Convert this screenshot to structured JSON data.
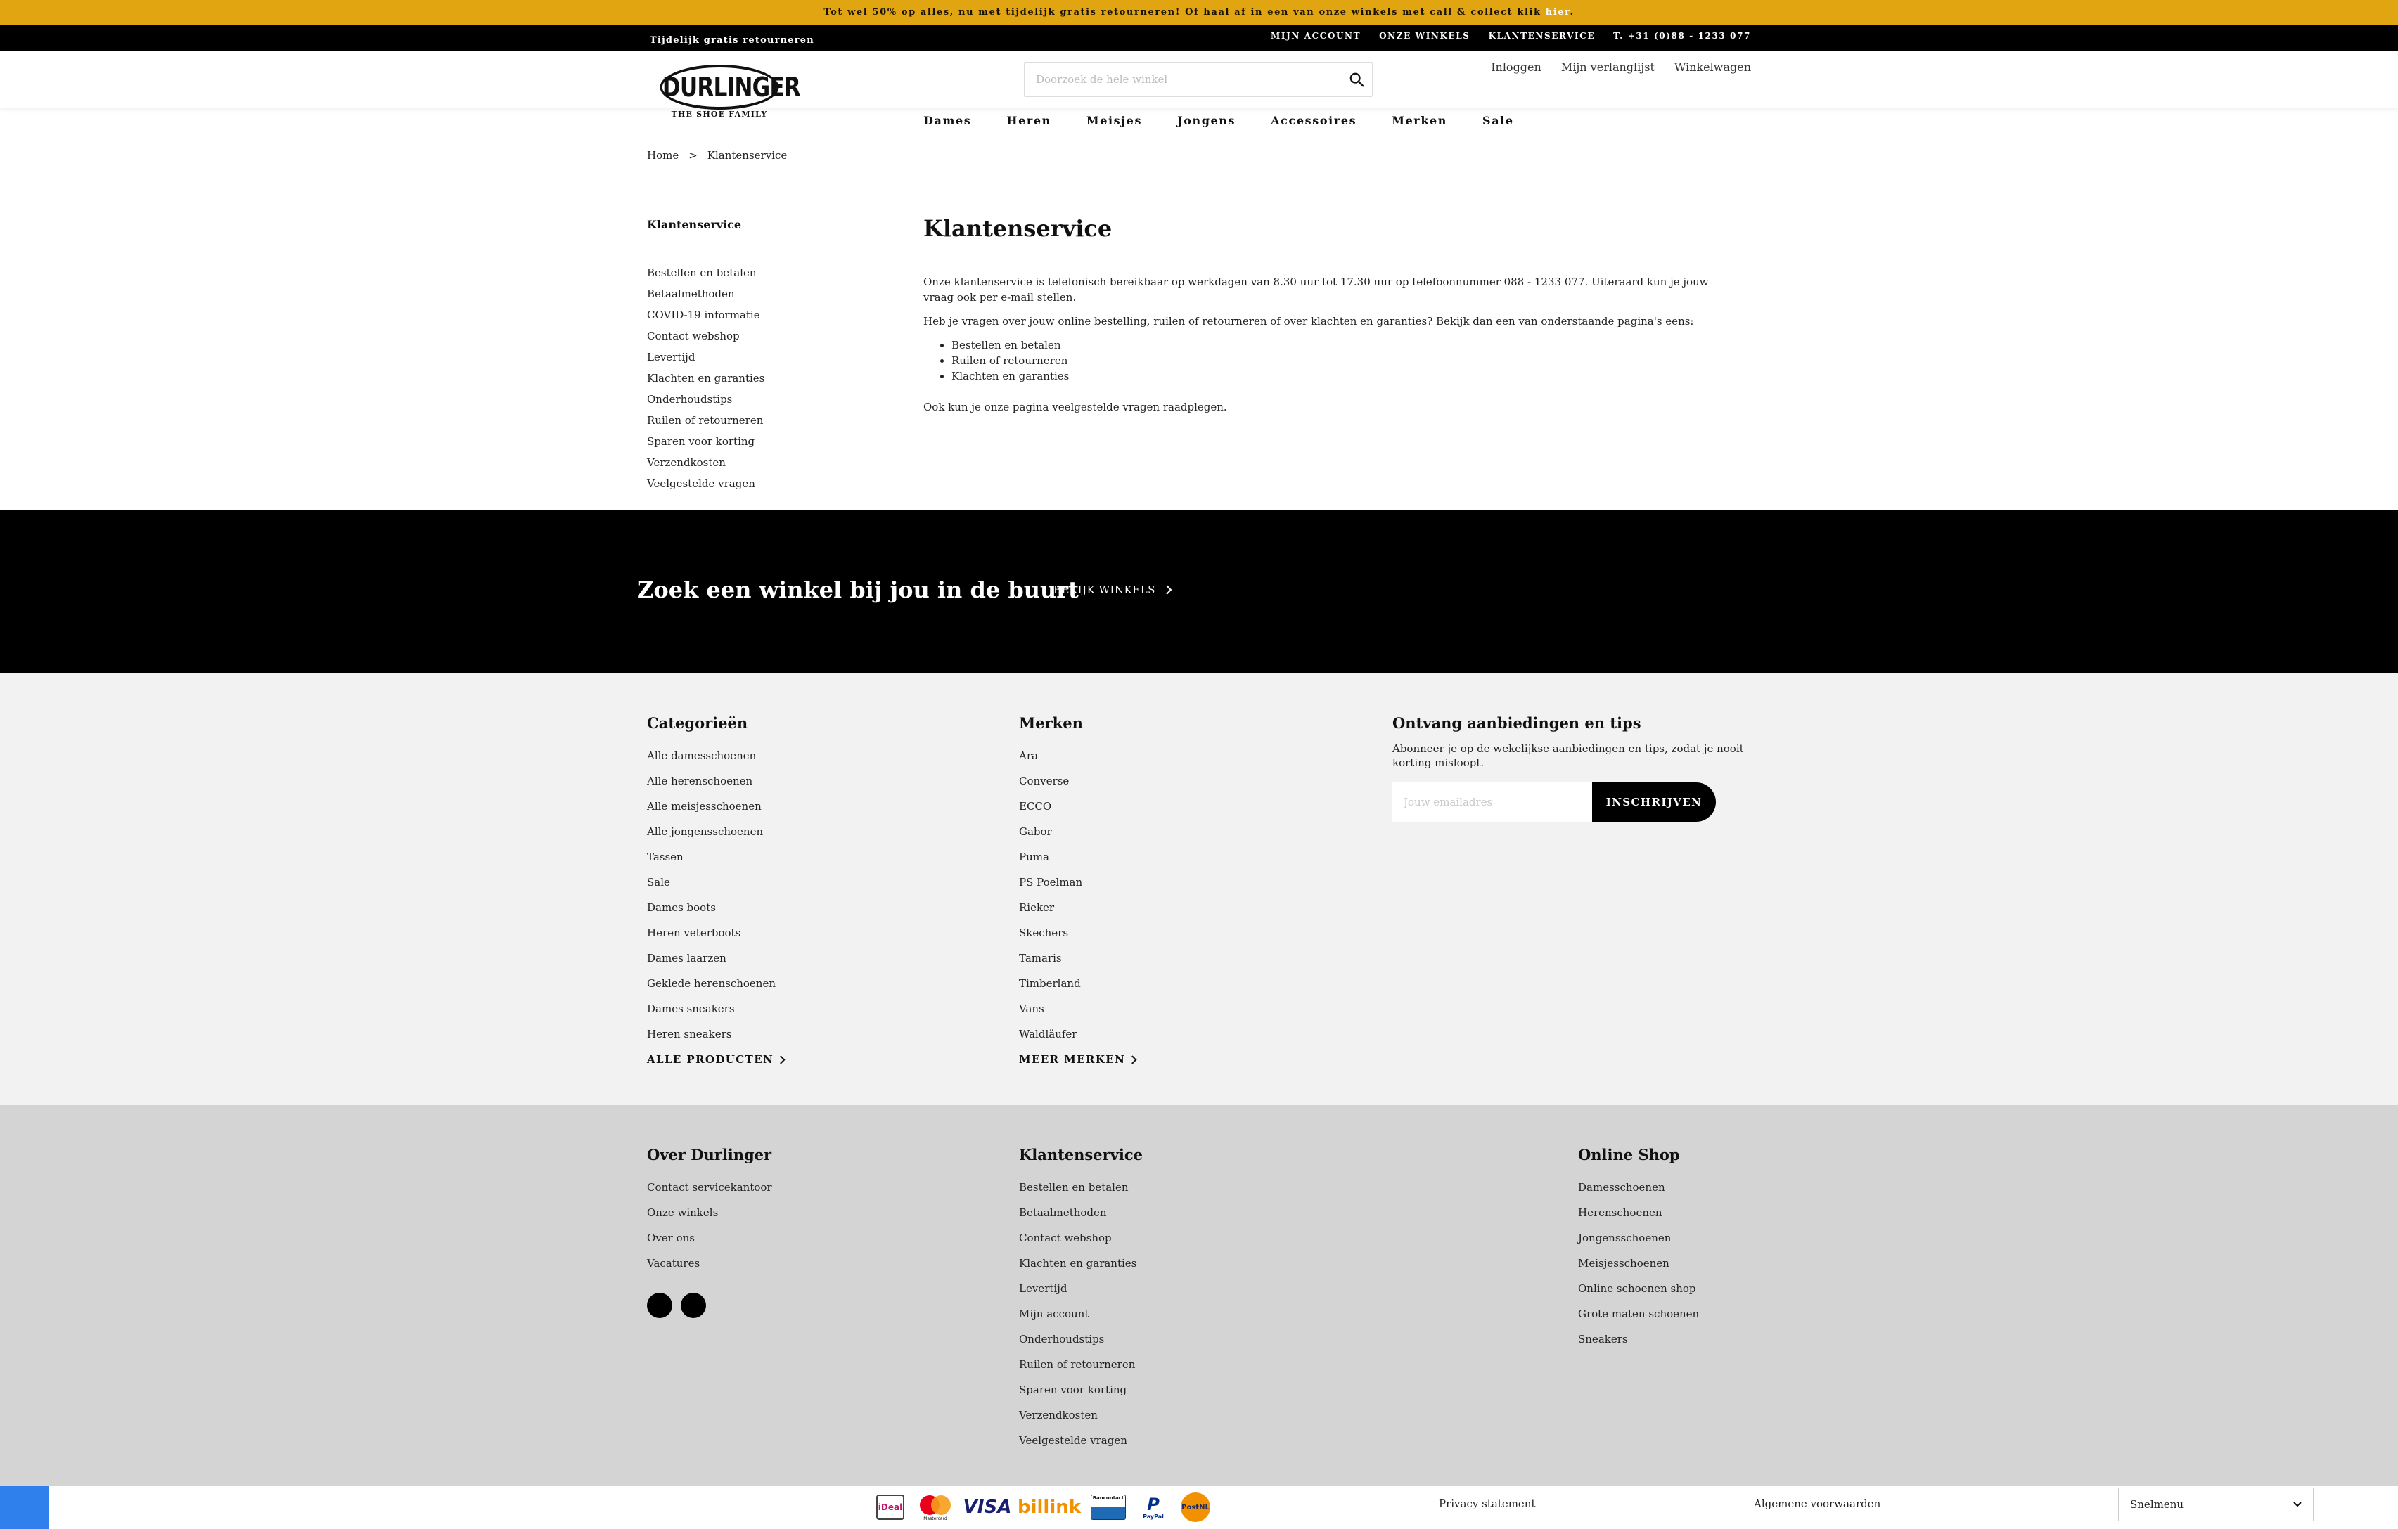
{
  "promo": {
    "text": "Tot wel 50% op alles, nu met tijdelijk gratis retourneren! Of haal af in een van onze winkels met call & collect klik",
    "link": "hier",
    "suffix": "."
  },
  "topbar": {
    "left": "Tijdelijk gratis retourneren",
    "links": [
      "MIJN ACCOUNT",
      "ONZE WINKELS",
      "KLANTENSERVICE",
      "T. +31 (0)88 - 1233 077"
    ]
  },
  "header": {
    "logo_text": "DURLINGER",
    "logo_sub": "THE SHOE FAMILY",
    "search_placeholder": "Doorzoek de hele winkel",
    "user_links": [
      "Inloggen",
      "Mijn verlanglijst",
      "Winkelwagen"
    ]
  },
  "nav": [
    "Dames",
    "Heren",
    "Meisjes",
    "Jongens",
    "Accessoires",
    "Merken",
    "Sale"
  ],
  "breadcrumb": {
    "home": "Home",
    "separator": ">",
    "current": "Klantenservice"
  },
  "sidebar": {
    "title": "Klantenservice",
    "items": [
      "Bestellen en betalen",
      "Betaalmethoden",
      "COVID-19 informatie",
      "Contact webshop",
      "Levertijd",
      "Klachten en garanties",
      "Onderhoudstips",
      "Ruilen of retourneren",
      "Sparen voor korting",
      "Verzendkosten",
      "Veelgestelde vragen"
    ]
  },
  "content": {
    "title": "Klantenservice",
    "p1": "Onze klantenservice is telefonisch bereikbaar op werkdagen van 8.30 uur tot 17.30 uur op telefoonnummer 088 - 1233 077. Uiteraard kun je jouw vraag ook per e-mail stellen.",
    "p2": "Heb je vragen over jouw online bestelling, ruilen of retourneren of over klachten en garanties? Bekijk dan een van onderstaande pagina's eens:",
    "list": [
      "Bestellen en betalen",
      "Ruilen of retourneren",
      "Klachten en garanties"
    ],
    "p3": "Ook kun je onze pagina veelgestelde vragen raadplegen."
  },
  "storeband": {
    "title": "Zoek een winkel bij jou in de buurt",
    "link": "BEKIJK WINKELS"
  },
  "footer_top": {
    "categories": {
      "title": "Categorieën",
      "items": [
        "Alle damesschoenen",
        "Alle herenschoenen",
        "Alle meisjesschoenen",
        "Alle jongensschoenen",
        "Tassen",
        "Sale",
        "Dames boots",
        "Heren veterboots",
        "Dames laarzen",
        "Geklede herenschoenen",
        "Dames sneakers",
        "Heren sneakers"
      ],
      "more": "ALLE PRODUCTEN"
    },
    "brands": {
      "title": "Merken",
      "items": [
        "Ara",
        "Converse",
        "ECCO",
        "Gabor",
        "Puma",
        "PS Poelman",
        "Rieker",
        "Skechers",
        "Tamaris",
        "Timberland",
        "Vans",
        "Waldläufer"
      ],
      "more": "MEER MERKEN"
    },
    "newsletter": {
      "title": "Ontvang aanbiedingen en tips",
      "text": "Abonneer je op de wekelijkse aanbiedingen en tips, zodat je nooit korting misloopt.",
      "placeholder": "Jouw emailadres",
      "button": "INSCHRIJVEN"
    }
  },
  "footer_bottom": {
    "about": {
      "title": "Over Durlinger",
      "items": [
        "Contact servicekantoor",
        "Onze winkels",
        "Over ons",
        "Vacatures"
      ]
    },
    "service": {
      "title": "Klantenservice",
      "items": [
        "Bestellen en betalen",
        "Betaalmethoden",
        "Contact webshop",
        "Klachten en garanties",
        "Levertijd",
        "Mijn account",
        "Onderhoudstips",
        "Ruilen of retourneren",
        "Sparen voor korting",
        "Verzendkosten",
        "Veelgestelde vragen"
      ]
    },
    "shop": {
      "title": "Online Shop",
      "items": [
        "Damesschoenen",
        "Herenschoenen",
        "Jongensschoenen",
        "Meisjesschoenen",
        "Online schoenen shop",
        "Grote maten schoenen",
        "Sneakers"
      ]
    }
  },
  "bottombar": {
    "payments": [
      "iDeal",
      "Mastercard",
      "VISA",
      "billink",
      "Bancontact",
      "PayPal",
      "PostNL"
    ],
    "privacy": "Privacy statement",
    "terms": "Algemene voorwaarden",
    "snelmenu": "Snelmenu"
  },
  "colors": {
    "promo": "#E1A512",
    "dark": "#000000",
    "footer_light": "#F2F2F2",
    "footer_gray": "#D4D4D4",
    "chat": "#2F80ED"
  }
}
